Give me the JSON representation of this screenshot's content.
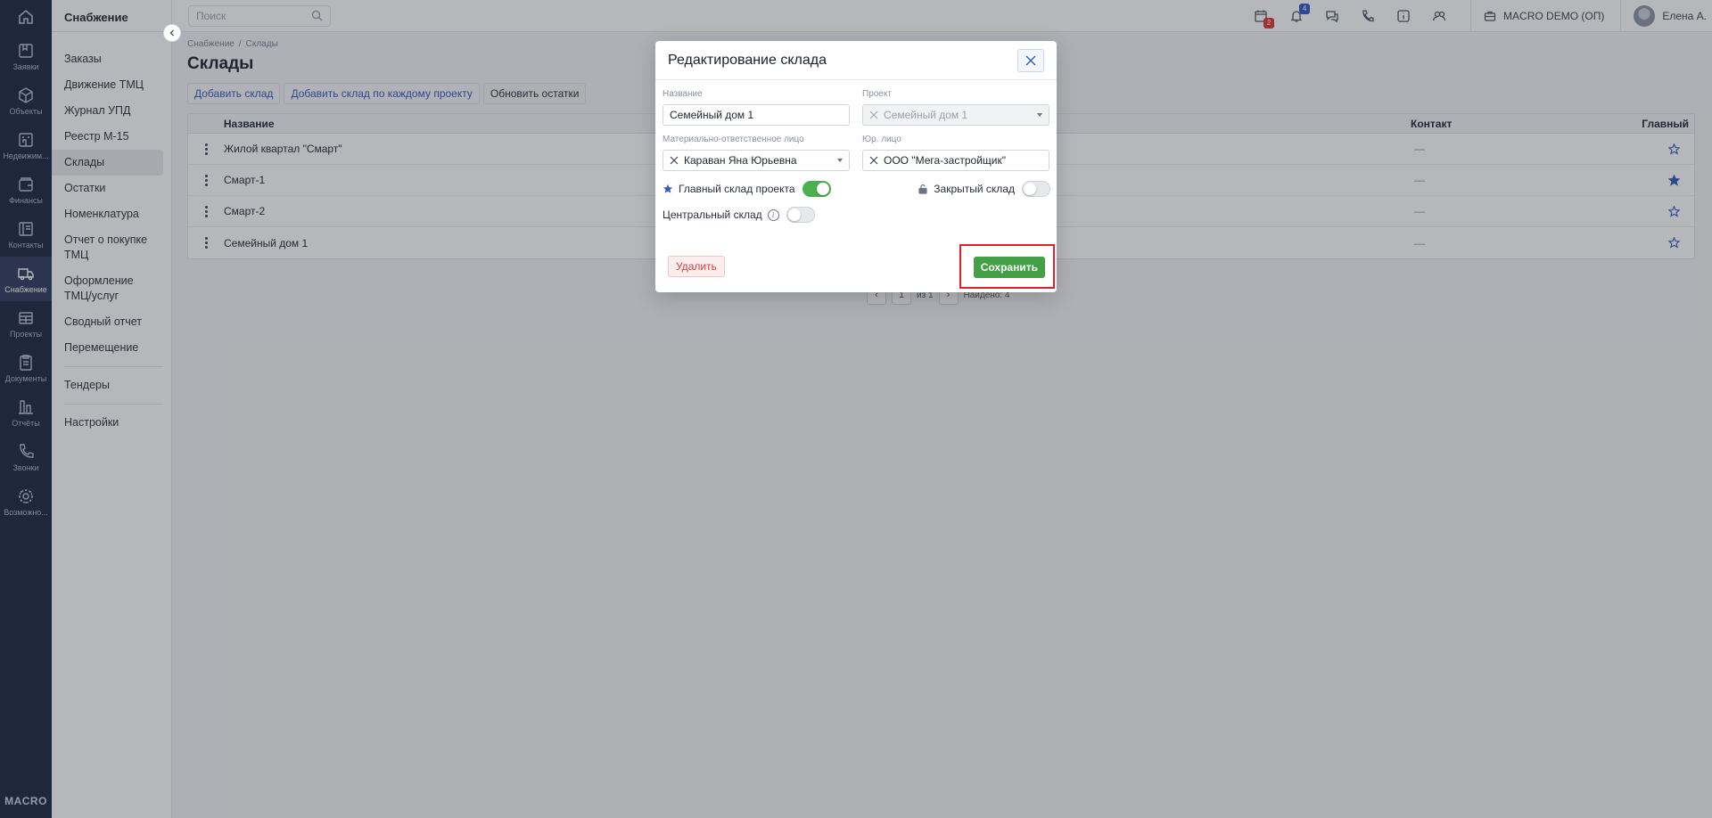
{
  "rail": {
    "items": [
      {
        "label": "Заявки",
        "icon": "requests-icon"
      },
      {
        "label": "Объекты",
        "icon": "cube-icon"
      },
      {
        "label": "Недвижим...",
        "icon": "building-icon"
      },
      {
        "label": "Финансы",
        "icon": "wallet-icon"
      },
      {
        "label": "Контакты",
        "icon": "contacts-icon"
      },
      {
        "label": "Снабжение",
        "icon": "truck-icon",
        "active": true
      },
      {
        "label": "Проекты",
        "icon": "projects-icon"
      },
      {
        "label": "Документы",
        "icon": "document-icon"
      },
      {
        "label": "Отчёты",
        "icon": "reports-icon"
      },
      {
        "label": "Звонки",
        "icon": "phone-icon"
      },
      {
        "label": "Возможно...",
        "icon": "gear-icon"
      }
    ],
    "brand": "MACRO"
  },
  "sidebar": {
    "title": "Снабжение",
    "items": [
      "Заказы",
      "Движение ТМЦ",
      "Журнал УПД",
      "Реестр М-15",
      "Склады",
      "Остатки",
      "Номенклатура",
      "Отчет о покупке ТМЦ",
      "Оформление ТМЦ/услуг",
      "Сводный отчет",
      "Перемещение",
      "Тендеры",
      "Настройки"
    ],
    "active_index": 4
  },
  "topbar": {
    "search_placeholder": "Поиск",
    "calendar_badge": "2",
    "notifications_badge": "4",
    "company": "MACRO DEMO (ОП)",
    "user": "Елена А."
  },
  "main": {
    "breadcrumb": [
      "Снабжение",
      "/",
      "Склады"
    ],
    "title": "Склады",
    "actions": {
      "add": "Добавить склад",
      "add_each": "Добавить склад по каждому проекту",
      "refresh": "Обновить остатки"
    },
    "table": {
      "headers": {
        "name": "Название",
        "contact": "Контакт",
        "main": "Главный"
      },
      "rows": [
        {
          "name": "Жилой квартал \"Смарт\"",
          "contact": "—",
          "main": false
        },
        {
          "name": "Смарт-1",
          "contact": "—",
          "main": true
        },
        {
          "name": "Смарт-2",
          "contact": "—",
          "main": false
        },
        {
          "name": "Семейный дом 1",
          "contact": "—",
          "main": false
        }
      ]
    },
    "pagination": {
      "page": "1",
      "of": "из 1",
      "found": "Найдено: 4"
    }
  },
  "modal": {
    "title": "Редактирование склада",
    "fields": {
      "name_label": "Название",
      "name_value": "Семейный дом 1",
      "project_label": "Проект",
      "project_value": "Семейный дом 1",
      "mol_label": "Материально-ответственное лицо",
      "mol_value": "Караван Яна Юрьевна",
      "legal_label": "Юр. лицо",
      "legal_value": "ООО \"Мега-застройщик\""
    },
    "toggles": {
      "main_label": "Главный склад проекта",
      "main_on": true,
      "closed_label": "Закрытый склад",
      "closed_on": false,
      "central_label": "Центральный склад",
      "central_on": false
    },
    "delete_label": "Удалить",
    "save_label": "Сохранить"
  },
  "colors": {
    "rail_bg": "#1b2540",
    "accent_blue": "#3159b8",
    "save_green": "#43a047",
    "delete_red": "#d24040",
    "highlight_red": "#e0202a"
  }
}
